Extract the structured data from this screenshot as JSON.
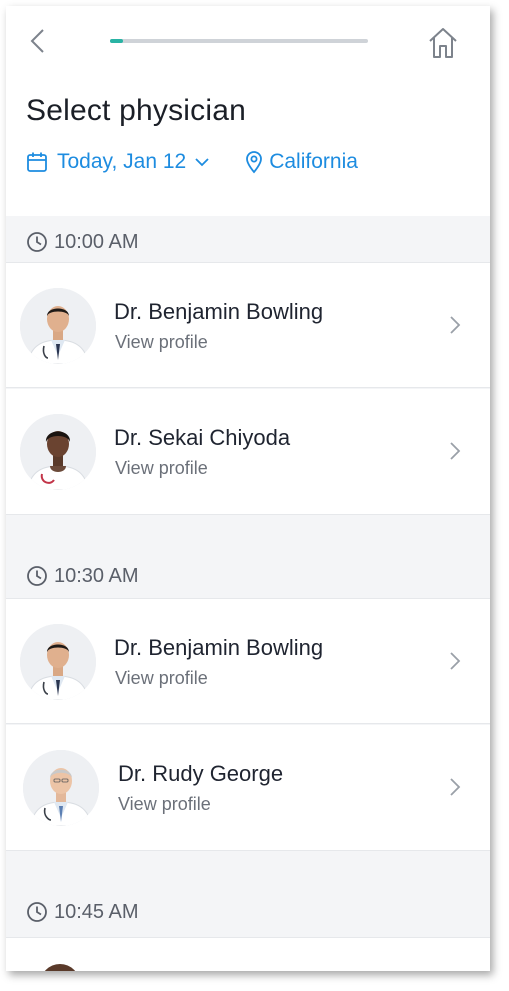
{
  "header": {
    "progress_percent": 5,
    "title": "Select physician"
  },
  "filters": {
    "date_label": "Today, Jan 12",
    "location_label": "California"
  },
  "accent_color": "#1d8ce0",
  "progress_color": "#29b3a4",
  "slots": [
    {
      "time": "10:00 AM",
      "doctors": [
        {
          "name": "Dr. Benjamin Bowling",
          "link": "View profile"
        },
        {
          "name": "Dr. Sekai Chiyoda",
          "link": "View profile"
        }
      ]
    },
    {
      "time": "10:30 AM",
      "doctors": [
        {
          "name": "Dr. Benjamin Bowling",
          "link": "View profile"
        },
        {
          "name": "Dr. Rudy George",
          "link": "View profile"
        }
      ]
    },
    {
      "time": "10:45 AM",
      "doctors": []
    }
  ]
}
